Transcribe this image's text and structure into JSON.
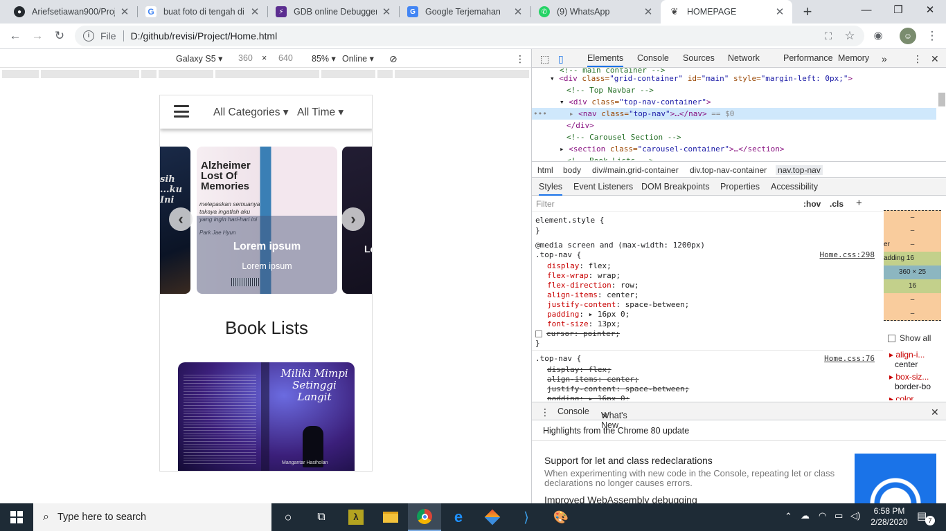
{
  "browser": {
    "tabs": [
      {
        "title": "Ariefsetiawan900/Proje",
        "icon": "github-icon"
      },
      {
        "title": "buat foto di tengah di r",
        "icon": "google-icon"
      },
      {
        "title": "GDB online Debugger |",
        "icon": "gdb-icon"
      },
      {
        "title": "Google Terjemahan",
        "icon": "translate-icon"
      },
      {
        "title": "(9) WhatsApp",
        "icon": "whatsapp-icon"
      },
      {
        "title": "HOMEPAGE",
        "icon": "book-icon"
      }
    ],
    "omnibox": {
      "scheme": "File",
      "url": "D:/github/revisi/Project/Home.html"
    }
  },
  "device_toolbar": {
    "device": "Galaxy S5",
    "width": "360",
    "height": "640",
    "times": "×",
    "zoom": "85%",
    "throttle": "Online"
  },
  "page": {
    "nav": {
      "categories": "All Categories",
      "time": "All Time"
    },
    "carousel": {
      "caption_title": "Lorem ipsum",
      "caption_text": "Lorem ipsum",
      "book_title": "Alzheimer Lost Of Memories",
      "quote": "melepaskan semuanya takaya ingatlah aku yang ingin hari-hari ini",
      "author": "Park Jae Hyun",
      "left_slide": "sih ...ku Ini",
      "right_label": "Lo"
    },
    "section_title": "Book Lists",
    "book": {
      "title": "Miliki Mimpi Setinggi Langit",
      "author": "Mangantar Hasiholan"
    }
  },
  "devtools": {
    "tabs": [
      "Elements",
      "Console",
      "Sources",
      "Network",
      "Performance",
      "Memory"
    ],
    "dom": {
      "l0": "<!-- main container -->",
      "l1_tag": "<div",
      "l1_a1": " class=",
      "l1_v1": "\"grid-container\"",
      "l1_a2": " id=",
      "l1_v2": "\"main\"",
      "l1_a3": " style=",
      "l1_v3": "\"margin-left: 0px;\"",
      "l1_end": ">",
      "l2": "<!-- Top Navbar -->",
      "l3_tag": "<div",
      "l3_a1": " class=",
      "l3_v1": "\"top-nav-container\"",
      "l3_end": ">",
      "l4_tag": "<nav",
      "l4_a1": " class=",
      "l4_v1": "\"top-nav\"",
      "l4_end": ">…</nav>",
      "l4_eq": " == $0",
      "l5": "</div>",
      "l6": "<!-- Carousel Section -->",
      "l7_tag": "<section",
      "l7_a1": " class=",
      "l7_v1": "\"carousel-container\"",
      "l7_end": ">…</section>",
      "l8": "<!-- Book Lists -->"
    },
    "breadcrumbs": [
      "html",
      "body",
      "div#main.grid-container",
      "div.top-nav-container",
      "nav.top-nav"
    ],
    "subtabs": [
      "Styles",
      "Event Listeners",
      "DOM Breakpoints",
      "Properties",
      "Accessibility"
    ],
    "filter": {
      "placeholder": "Filter",
      "hov": ":hov",
      "cls": ".cls"
    },
    "styles": {
      "element_style": "element.style {",
      "close": "}",
      "media": "@media screen and (max-width: 1200px)",
      "rule1_selector": ".top-nav {",
      "rule1_source": "Home.css:298",
      "rule1": [
        {
          "p": "display",
          "v": "flex;"
        },
        {
          "p": "flex-wrap",
          "v": "wrap;"
        },
        {
          "p": "flex-direction",
          "v": "row;"
        },
        {
          "p": "align-items",
          "v": "center;"
        },
        {
          "p": "justify-content",
          "v": "space-between;"
        },
        {
          "p": "padding",
          "v": "▸ 16px 0;"
        },
        {
          "p": "font-size",
          "v": "13px;"
        }
      ],
      "rule1_disabled": "cursor: pointer;",
      "rule2_selector": ".top-nav {",
      "rule2_source": "Home.css:76",
      "rule2": [
        "display: flex;",
        "align-items: center;",
        "justify-content: space-between;",
        "padding: ▸ 16px 0;"
      ]
    },
    "boxmodel": [
      "–",
      "–",
      "er",
      "–",
      "adding 16",
      "360 × 25",
      "16",
      "–",
      "–"
    ],
    "computed": {
      "show_all": "Show all",
      "p1": "align-i...",
      "v1": "center",
      "p2": "box-siz...",
      "v2": "border-bo",
      "p3": "color"
    },
    "drawer": {
      "tabs": [
        "Console",
        "What's New"
      ],
      "highlights": "Highlights from the Chrome 80 update",
      "item1_title": "Support for let and class redeclarations",
      "item1_desc": "When experimenting with new code in the Console, repeating let or class declarations no longer causes errors.",
      "item2_title": "Improved WebAssembly debugging"
    }
  },
  "taskbar": {
    "search_placeholder": "Type here to search",
    "time": "6:58 PM",
    "date": "2/28/2020",
    "notifications": "7"
  },
  "colors": {
    "accent": "#1a73e8",
    "taskbar": "#1e2b36",
    "tabstrip": "#dee1e6"
  }
}
